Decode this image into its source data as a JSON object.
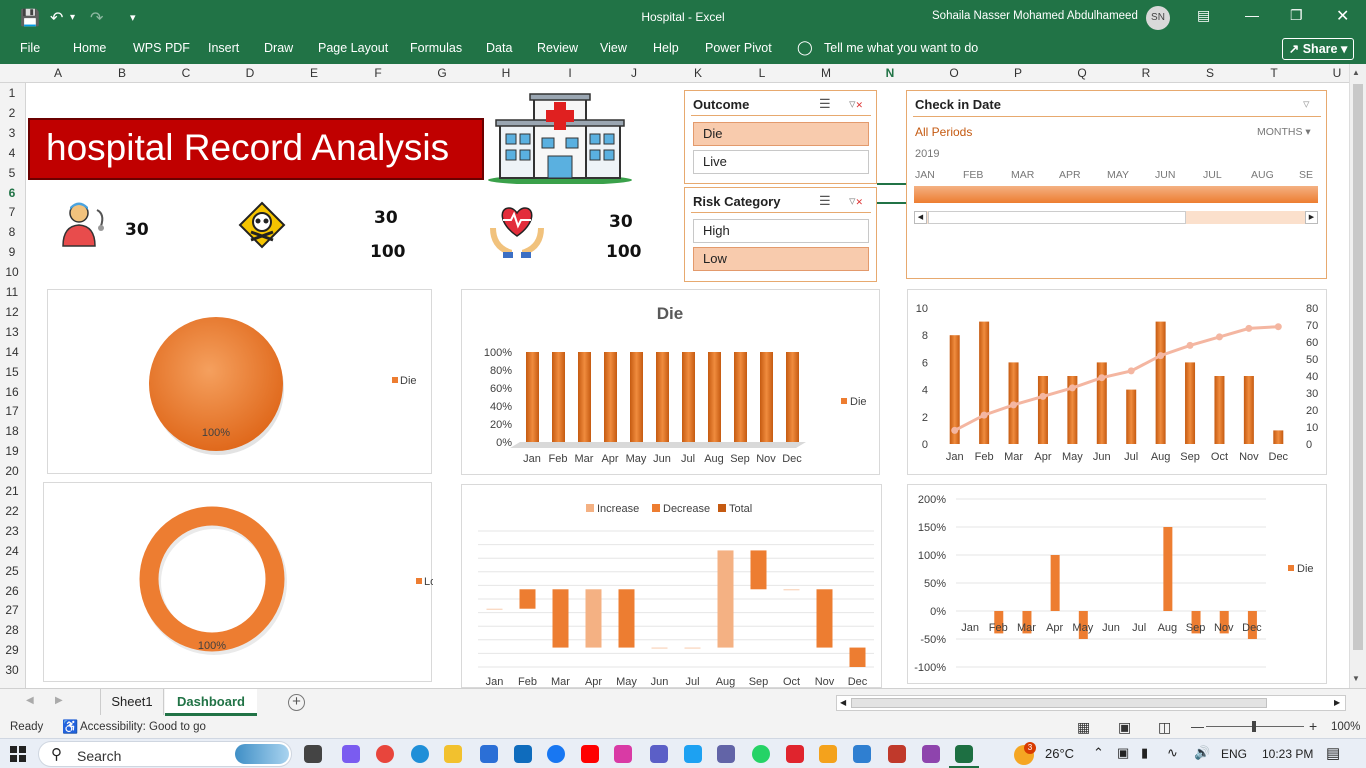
{
  "window": {
    "title": "Hospital  -  Excel",
    "user": "Sohaila Nasser Mohamed Abdulhameed",
    "avatar_initials": "SN"
  },
  "menu": [
    "File",
    "Home",
    "WPS PDF",
    "Insert",
    "Draw",
    "Page Layout",
    "Formulas",
    "Data",
    "Review",
    "View",
    "Help",
    "Power Pivot"
  ],
  "tell_me": "Tell me what you want to do",
  "share_label": "Share",
  "columns": [
    "A",
    "B",
    "C",
    "D",
    "E",
    "F",
    "G",
    "H",
    "I",
    "J",
    "K",
    "L",
    "M",
    "N",
    "O",
    "P",
    "Q",
    "R",
    "S",
    "T",
    "U"
  ],
  "rows": [
    "1",
    "2",
    "3",
    "4",
    "5",
    "6",
    "7",
    "8",
    "9",
    "10",
    "11",
    "12",
    "13",
    "14",
    "15",
    "16",
    "17",
    "18",
    "19",
    "20",
    "21",
    "22",
    "23",
    "24",
    "25",
    "26",
    "27",
    "28",
    "29",
    "30"
  ],
  "dashboard": {
    "title": "hospital Record Analysis",
    "kpis": {
      "patients": "30",
      "deaths_count": "30",
      "deaths_pct": "100",
      "health_count": "30",
      "health_pct": "100"
    }
  },
  "slicers": {
    "outcome": {
      "title": "Outcome",
      "items": [
        "Die",
        "Live"
      ],
      "selected": "Die"
    },
    "risk": {
      "title": "Risk Category",
      "items": [
        "High",
        "Low"
      ],
      "selected": "Low"
    },
    "timeline": {
      "title": "Check in Date",
      "period": "All Periods",
      "level": "MONTHS",
      "year": "2019",
      "months": [
        "JAN",
        "FEB",
        "MAR",
        "APR",
        "MAY",
        "JUN",
        "JUL",
        "AUG",
        "SE"
      ]
    }
  },
  "chart_data": [
    {
      "type": "pie",
      "legend": [
        "Die"
      ],
      "values": [
        100
      ],
      "data_labels": [
        "100%"
      ],
      "color": "#ed7d31"
    },
    {
      "type": "bar",
      "title": "Die",
      "categories": [
        "Jan",
        "Feb",
        "Mar",
        "Apr",
        "May",
        "Jun",
        "Jul",
        "Aug",
        "Sep",
        "Nov",
        "Dec"
      ],
      "values": [
        100,
        100,
        100,
        100,
        100,
        100,
        100,
        100,
        100,
        100,
        100
      ],
      "ylim": [
        0,
        100
      ],
      "yticks": [
        "0%",
        "20%",
        "40%",
        "60%",
        "80%",
        "100%"
      ],
      "legend": [
        "Die"
      ]
    },
    {
      "type": "bar",
      "categories": [
        "Jan",
        "Feb",
        "Mar",
        "Apr",
        "May",
        "Jun",
        "Jul",
        "Aug",
        "Sep",
        "Oct",
        "Nov",
        "Dec"
      ],
      "values": [
        8,
        9,
        6,
        5,
        5,
        6,
        4,
        9,
        6,
        5,
        5,
        1
      ],
      "ylim": [
        0,
        10
      ],
      "yticks": [
        "0",
        "2",
        "4",
        "6",
        "8",
        "10"
      ],
      "line_values": [
        8,
        17,
        23,
        28,
        33,
        39,
        43,
        52,
        58,
        63,
        68,
        69
      ],
      "y2lim": [
        0,
        80
      ],
      "y2ticks": [
        "0",
        "10",
        "20",
        "30",
        "40",
        "50",
        "60",
        "70",
        "80"
      ]
    },
    {
      "type": "pie",
      "legend": [
        "Low"
      ],
      "values": [
        100
      ],
      "data_labels": [
        "100%"
      ],
      "color": "#ed7d31"
    },
    {
      "type": "bar",
      "legend": [
        "Increase",
        "Decrease",
        "Total"
      ],
      "categories": [
        "Jan",
        "Feb",
        "Mar",
        "Apr",
        "May",
        "Jun",
        "Jul",
        "Aug",
        "Sep",
        "Oct",
        "Nov",
        "Dec"
      ],
      "bars": [
        {
          "start": 8,
          "end": 8
        },
        {
          "start": 8,
          "end": 9
        },
        {
          "start": 9,
          "end": 6
        },
        {
          "start": 6,
          "end": 9
        },
        {
          "start": 9,
          "end": 6
        },
        {
          "start": 6,
          "end": 6
        },
        {
          "start": 6,
          "end": 6
        },
        {
          "start": 6,
          "end": 11
        },
        {
          "start": 11,
          "end": 9
        },
        {
          "start": 9,
          "end": 9
        },
        {
          "start": 9,
          "end": 6
        },
        {
          "start": 6,
          "end": 5
        }
      ],
      "kinds": [
        "Total",
        "Decrease",
        "Decrease",
        "Increase",
        "Decrease",
        "Total",
        "Total",
        "Increase",
        "Decrease",
        "Total",
        "Decrease",
        "Decrease"
      ],
      "ylim": [
        5,
        12
      ]
    },
    {
      "type": "bar",
      "categories": [
        "Jan",
        "Feb",
        "Mar",
        "Apr",
        "May",
        "Jun",
        "Jul",
        "Aug",
        "Sep",
        "Nov",
        "Dec"
      ],
      "values": [
        0,
        -40,
        -40,
        100,
        -50,
        0,
        0,
        150,
        -40,
        -40,
        -50
      ],
      "ylim": [
        -100,
        200
      ],
      "yticks": [
        "-100%",
        "-50%",
        "0%",
        "50%",
        "100%",
        "150%",
        "200%"
      ],
      "legend": [
        "Die"
      ]
    }
  ],
  "colors": {
    "accent": "#ed7d31",
    "excel_green": "#217346",
    "banner_red": "#c00000",
    "increase": "#f4b183",
    "total": "#c55a11"
  },
  "sheet_tabs": [
    "Sheet1",
    "Dashboard"
  ],
  "active_tab": "Dashboard",
  "status": {
    "ready": "Ready",
    "accessibility": "Accessibility: Good to go",
    "zoom": "100%"
  },
  "taskbar": {
    "search": "Search",
    "weather": "26°C",
    "lang": "ENG",
    "time": "10:23 PM",
    "badge": "3"
  }
}
